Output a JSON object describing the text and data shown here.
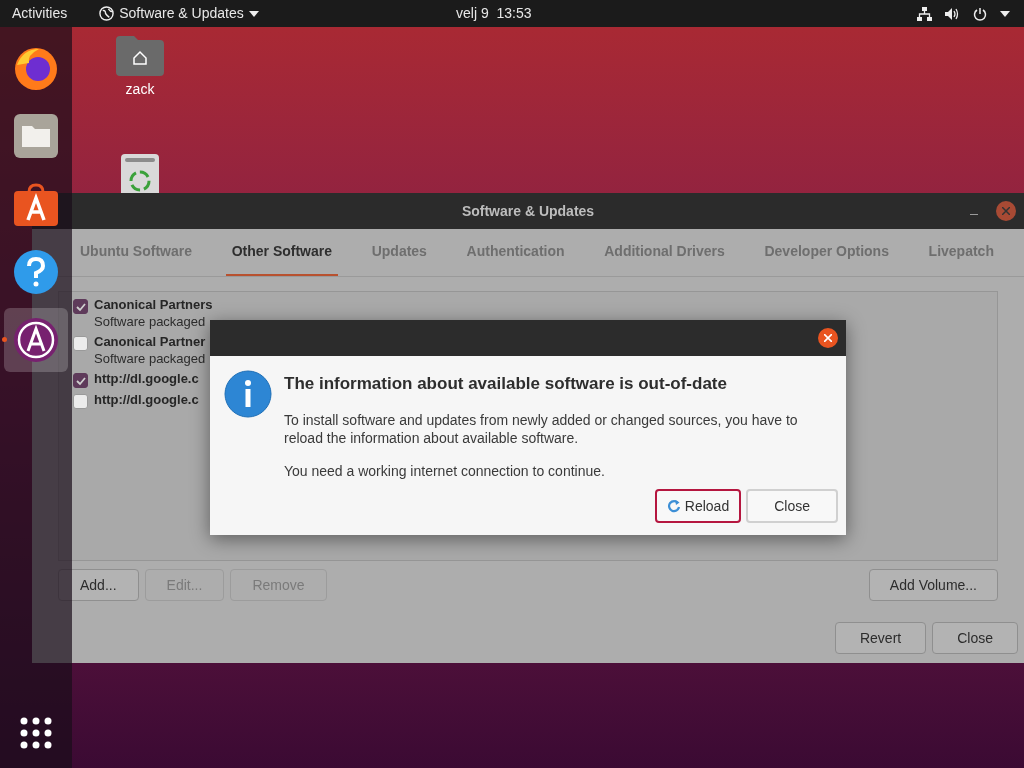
{
  "top_bar": {
    "activities": "Activities",
    "app_menu": "Software & Updates",
    "clock": "velj 9  13:53"
  },
  "desktop_icons": [
    {
      "kind": "home",
      "label": "zack"
    },
    {
      "kind": "trash"
    }
  ],
  "dock": [
    {
      "kind": "firefox",
      "running": false
    },
    {
      "kind": "files",
      "running": false
    },
    {
      "kind": "store",
      "running": false
    },
    {
      "kind": "help",
      "running": false
    },
    {
      "kind": "updater",
      "running": true
    }
  ],
  "window": {
    "title": "Software & Updates",
    "tabs": [
      {
        "label": "Ubuntu Software",
        "selected": false
      },
      {
        "label": "Other Software",
        "selected": true
      },
      {
        "label": "Updates",
        "selected": false
      },
      {
        "label": "Authentication",
        "selected": false
      },
      {
        "label": "Additional Drivers",
        "selected": false
      },
      {
        "label": "Developer Options",
        "selected": false
      },
      {
        "label": "Livepatch",
        "selected": false
      }
    ],
    "sources": [
      {
        "title": "Canonical Partners",
        "subtitle": "Software packaged",
        "checked": true
      },
      {
        "title": "Canonical Partner",
        "subtitle": "Software packaged",
        "checked": false
      },
      {
        "title": "http://dl.google.c",
        "checked": true
      },
      {
        "title": "http://dl.google.c",
        "checked": false
      }
    ],
    "list_buttons": [
      {
        "label": "Add...",
        "disabled": false
      },
      {
        "label": "Edit...",
        "disabled": true
      },
      {
        "label": "Remove",
        "disabled": true
      }
    ],
    "add_volume": "Add Volume...",
    "footer_buttons": [
      "Revert",
      "Close"
    ]
  },
  "dialog": {
    "heading": "The information about available software is out-of-date",
    "paragraphs": [
      "To install software and updates from newly added or changed sources, you have to reload the information about available software.",
      "You need a working internet connection to continue."
    ],
    "buttons": [
      {
        "label": "Reload",
        "kind": "reload",
        "focused": true
      },
      {
        "label": "Close",
        "kind": "plain",
        "focused": false
      }
    ]
  }
}
